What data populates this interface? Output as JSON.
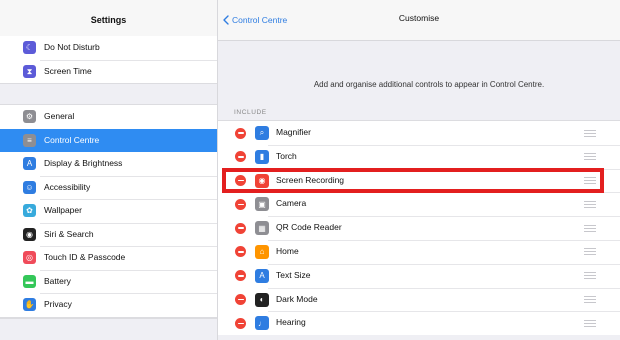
{
  "colors": {
    "selected_bg": "#2f8cf2",
    "accent_blue": "#2f7de1",
    "remove_red": "#f04336",
    "highlight_red": "#e31f1f"
  },
  "sidebar": {
    "title": "Settings",
    "group1": [
      {
        "label": "Do Not Disturb",
        "icon": "moon-icon",
        "color": "#5c5bd8"
      },
      {
        "label": "Screen Time",
        "icon": "hourglass-icon",
        "color": "#5c5bd8"
      }
    ],
    "group2": [
      {
        "label": "General",
        "icon": "gear-icon",
        "color": "#8e8e93"
      },
      {
        "label": "Control Centre",
        "icon": "toggles-icon",
        "color": "#8e8e93",
        "selected": true
      },
      {
        "label": "Display & Brightness",
        "icon": "text-size-icon",
        "color": "#2f7de1"
      },
      {
        "label": "Accessibility",
        "icon": "accessibility-icon",
        "color": "#2f7de1"
      },
      {
        "label": "Wallpaper",
        "icon": "flower-icon",
        "color": "#37aadc"
      },
      {
        "label": "Siri & Search",
        "icon": "siri-icon",
        "color": "#222"
      },
      {
        "label": "Touch ID & Passcode",
        "icon": "fingerprint-icon",
        "color": "#f04b5a"
      },
      {
        "label": "Battery",
        "icon": "battery-icon",
        "color": "#34c759"
      },
      {
        "label": "Privacy",
        "icon": "hand-icon",
        "color": "#2f7de1"
      }
    ]
  },
  "navbar": {
    "back_label": "Control Centre",
    "title": "Customise"
  },
  "description": "Add and organise additional controls to appear in Control Centre.",
  "section_label": "INCLUDE",
  "controls": [
    {
      "label": "Magnifier",
      "icon": "magnifier-icon",
      "color": "#2f7de1"
    },
    {
      "label": "Torch",
      "icon": "torch-icon",
      "color": "#2f7de1"
    },
    {
      "label": "Screen Recording",
      "icon": "record-icon",
      "color": "#f04336",
      "highlighted": true
    },
    {
      "label": "Camera",
      "icon": "camera-icon",
      "color": "#8e8e93"
    },
    {
      "label": "QR Code Reader",
      "icon": "qr-code-icon",
      "color": "#8e8e93"
    },
    {
      "label": "Home",
      "icon": "home-icon",
      "color": "#ff9500"
    },
    {
      "label": "Text Size",
      "icon": "text-size-icon",
      "color": "#2f7de1"
    },
    {
      "label": "Dark Mode",
      "icon": "dark-mode-icon",
      "color": "#222"
    },
    {
      "label": "Hearing",
      "icon": "ear-icon",
      "color": "#2f7de1"
    }
  ]
}
